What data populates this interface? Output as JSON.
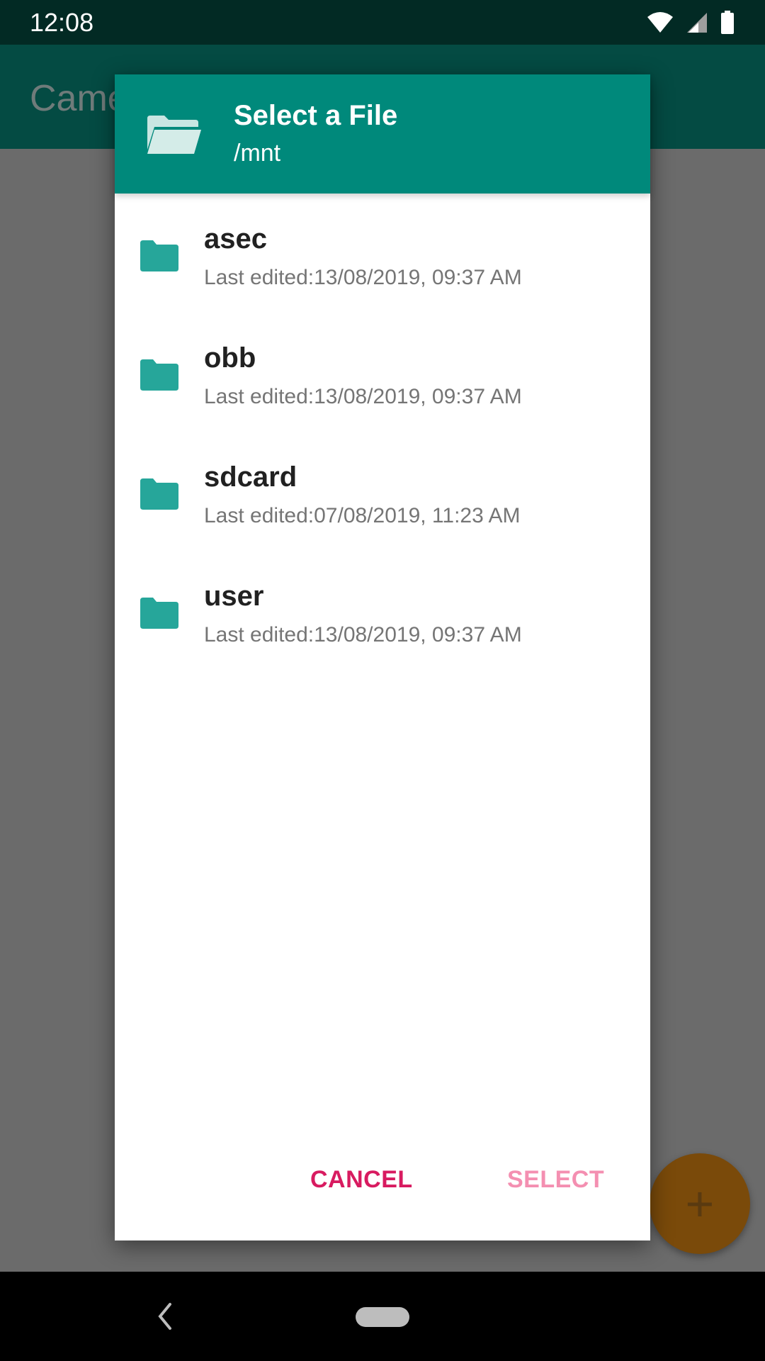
{
  "status_bar": {
    "time": "12:08"
  },
  "app_bar": {
    "title": "Came"
  },
  "dialog": {
    "title": "Select a File",
    "path": "/mnt",
    "files": [
      {
        "name": "asec",
        "meta": "Last edited:13/08/2019, 09:37 AM"
      },
      {
        "name": "obb",
        "meta": "Last edited:13/08/2019, 09:37 AM"
      },
      {
        "name": "sdcard",
        "meta": "Last edited:07/08/2019, 11:23 AM"
      },
      {
        "name": "user",
        "meta": "Last edited:13/08/2019, 09:37 AM"
      }
    ],
    "cancel_label": "CANCEL",
    "select_label": "SELECT"
  },
  "fab": {
    "icon": "plus-icon",
    "label": "+"
  },
  "colors": {
    "header": "#00897b",
    "folder": "#26a69a",
    "cancel": "#d81b60",
    "select_disabled": "#f48fb1"
  }
}
